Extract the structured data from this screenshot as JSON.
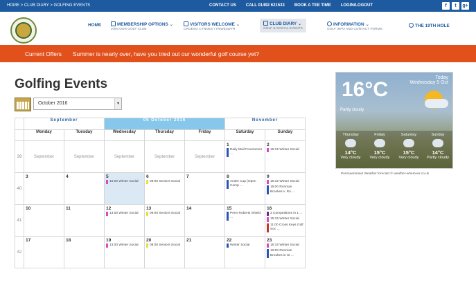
{
  "topbar": {
    "breadcrumb": "HOME > CLUB DIARY > GOLFING EVENTS",
    "links": [
      "CONTACT US",
      "CALL 01492 621533",
      "BOOK A TEE TIME",
      "LOGIN/LOGOUT"
    ],
    "social": [
      "f",
      "t",
      "g+"
    ]
  },
  "nav": {
    "home": "HOME",
    "items": [
      {
        "label": "MEMBERSHIP OPTIONS",
        "sub": "JOIN OUR GOLF CLUB"
      },
      {
        "label": "VISITORS WELCOME",
        "sub": "CROESO CYNNES I YMWELWYR"
      },
      {
        "label": "CLUB DIARY",
        "sub": "GOLF & SOCIAL EVENTS"
      },
      {
        "label": "INFORMATION",
        "sub": "GOLF INFO AND CONTACT FORMS"
      },
      {
        "label": "THE 19TH HOLE",
        "sub": ""
      }
    ]
  },
  "offers": {
    "label": "Current Offers",
    "message": "Summer is nearly over, have you tried out our wonderful golf course yet?"
  },
  "page": {
    "title": "Golfing Events",
    "month_select": "October 2016"
  },
  "calendar": {
    "months": {
      "prev": "September",
      "current": "05 October 2016",
      "next": "November"
    },
    "weekdays": [
      "Monday",
      "Tuesday",
      "Wednesday",
      "Thursday",
      "Friday",
      "Saturday",
      "Sunday"
    ],
    "weeks": [
      {
        "num": "39",
        "days": [
          {
            "prev": "September"
          },
          {
            "prev": "September"
          },
          {
            "prev": "September"
          },
          {
            "prev": "September"
          },
          {
            "prev": "September"
          },
          {
            "n": "1",
            "events": [
              {
                "t": "Daily Mail Foursomes ...",
                "c": "#2b55b5"
              }
            ]
          },
          {
            "n": "2",
            "events": [
              {
                "t": "15:15 Winter Social",
                "c": "#d44bc4"
              }
            ]
          }
        ]
      },
      {
        "num": "40",
        "days": [
          {
            "n": "3",
            "events": []
          },
          {
            "n": "4",
            "events": []
          },
          {
            "n": "5",
            "today": true,
            "events": [
              {
                "t": "15:00 Winter Social",
                "c": "#d44bc4"
              }
            ]
          },
          {
            "n": "6",
            "events": [
              {
                "t": "09:00 Seniors Social",
                "c": "#e7e03a"
              }
            ]
          },
          {
            "n": "7",
            "events": []
          },
          {
            "n": "8",
            "events": [
              {
                "t": "Andre Cup (Open Comp ...",
                "c": "#2b55b5"
              }
            ]
          },
          {
            "n": "9",
            "events": [
              {
                "t": "15:15 Winter Social",
                "c": "#d44bc4"
              },
              {
                "t": "15:00 Ronman Brookes v. Ro ...",
                "c": "#2b55b5"
              }
            ]
          }
        ]
      },
      {
        "num": "41",
        "days": [
          {
            "n": "10",
            "events": []
          },
          {
            "n": "11",
            "events": []
          },
          {
            "n": "12",
            "events": [
              {
                "t": "13:00 Winter Social",
                "c": "#d44bc4"
              }
            ]
          },
          {
            "n": "13",
            "events": [
              {
                "t": "09:00 Seniors Social",
                "c": "#e7e03a"
              }
            ]
          },
          {
            "n": "14",
            "events": []
          },
          {
            "n": "15",
            "events": [
              {
                "t": "Penn Roberts Shield ...",
                "c": "#2b55b5"
              }
            ]
          },
          {
            "n": "16",
            "events": [
              {
                "t": "3 Competitions in 1 ...",
                "c": "#6a2b8a"
              },
              {
                "t": "15:15 Winter Social",
                "c": "#d44bc4"
              },
              {
                "t": "11:00 Cross Keys Golf Soc ...",
                "c": "#c0392b"
              }
            ]
          }
        ]
      },
      {
        "num": "42",
        "days": [
          {
            "n": "17",
            "events": []
          },
          {
            "n": "18",
            "events": []
          },
          {
            "n": "19",
            "events": [
              {
                "t": "13:00 Winter Social",
                "c": "#d44bc4"
              }
            ]
          },
          {
            "n": "20",
            "events": [
              {
                "t": "09:00 Seniors Social",
                "c": "#e7e03a"
              }
            ]
          },
          {
            "n": "21",
            "events": []
          },
          {
            "n": "22",
            "events": [
              {
                "t": "Winter Social",
                "c": "#2b55b5"
              }
            ]
          },
          {
            "n": "23",
            "events": [
              {
                "t": "15:15 Winter Social",
                "c": "#d44bc4"
              },
              {
                "t": "10:00 Ronman Brookes in St ...",
                "c": "#2b55b5"
              }
            ]
          }
        ]
      }
    ]
  },
  "weather": {
    "temp": "16°C",
    "today_label": "Today",
    "today_date": "Wednesday 5 Oct",
    "condition": "Partly cloudy",
    "forecast": [
      {
        "day": "Thursday",
        "temp": "14°C",
        "desc": "Very cloudy"
      },
      {
        "day": "Friday",
        "temp": "15°C",
        "desc": "Very cloudy"
      },
      {
        "day": "Saturday",
        "temp": "15°C",
        "desc": "Very cloudy"
      },
      {
        "day": "Sunday",
        "temp": "14°C",
        "desc": "Partly cloudy"
      }
    ],
    "note": "Penmaenmawr Weather forecast © weather-wherever.co.uk"
  }
}
